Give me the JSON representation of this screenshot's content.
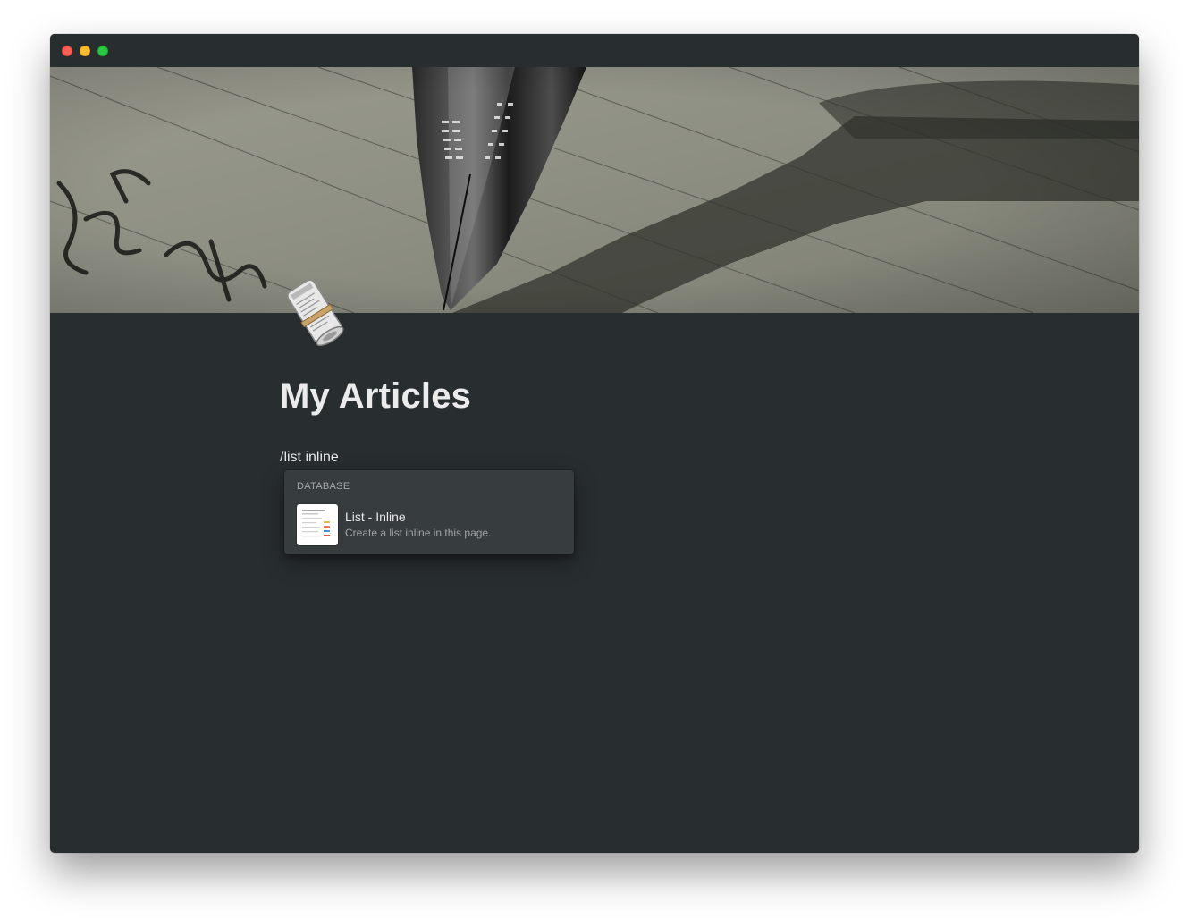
{
  "window": {
    "controls": [
      "close",
      "minimize",
      "maximize"
    ]
  },
  "page": {
    "icon": "rolled-newspaper-icon",
    "title": "My Articles"
  },
  "editor": {
    "current_line": "/list inline"
  },
  "slash_menu": {
    "section": "DATABASE",
    "items": [
      {
        "title": "List - Inline",
        "description": "Create a list inline in this page.",
        "icon": "list-database-thumbnail-icon"
      }
    ]
  },
  "colors": {
    "background": "#282d30",
    "menu_background": "#373c3f",
    "title_text": "#ebebeb"
  }
}
